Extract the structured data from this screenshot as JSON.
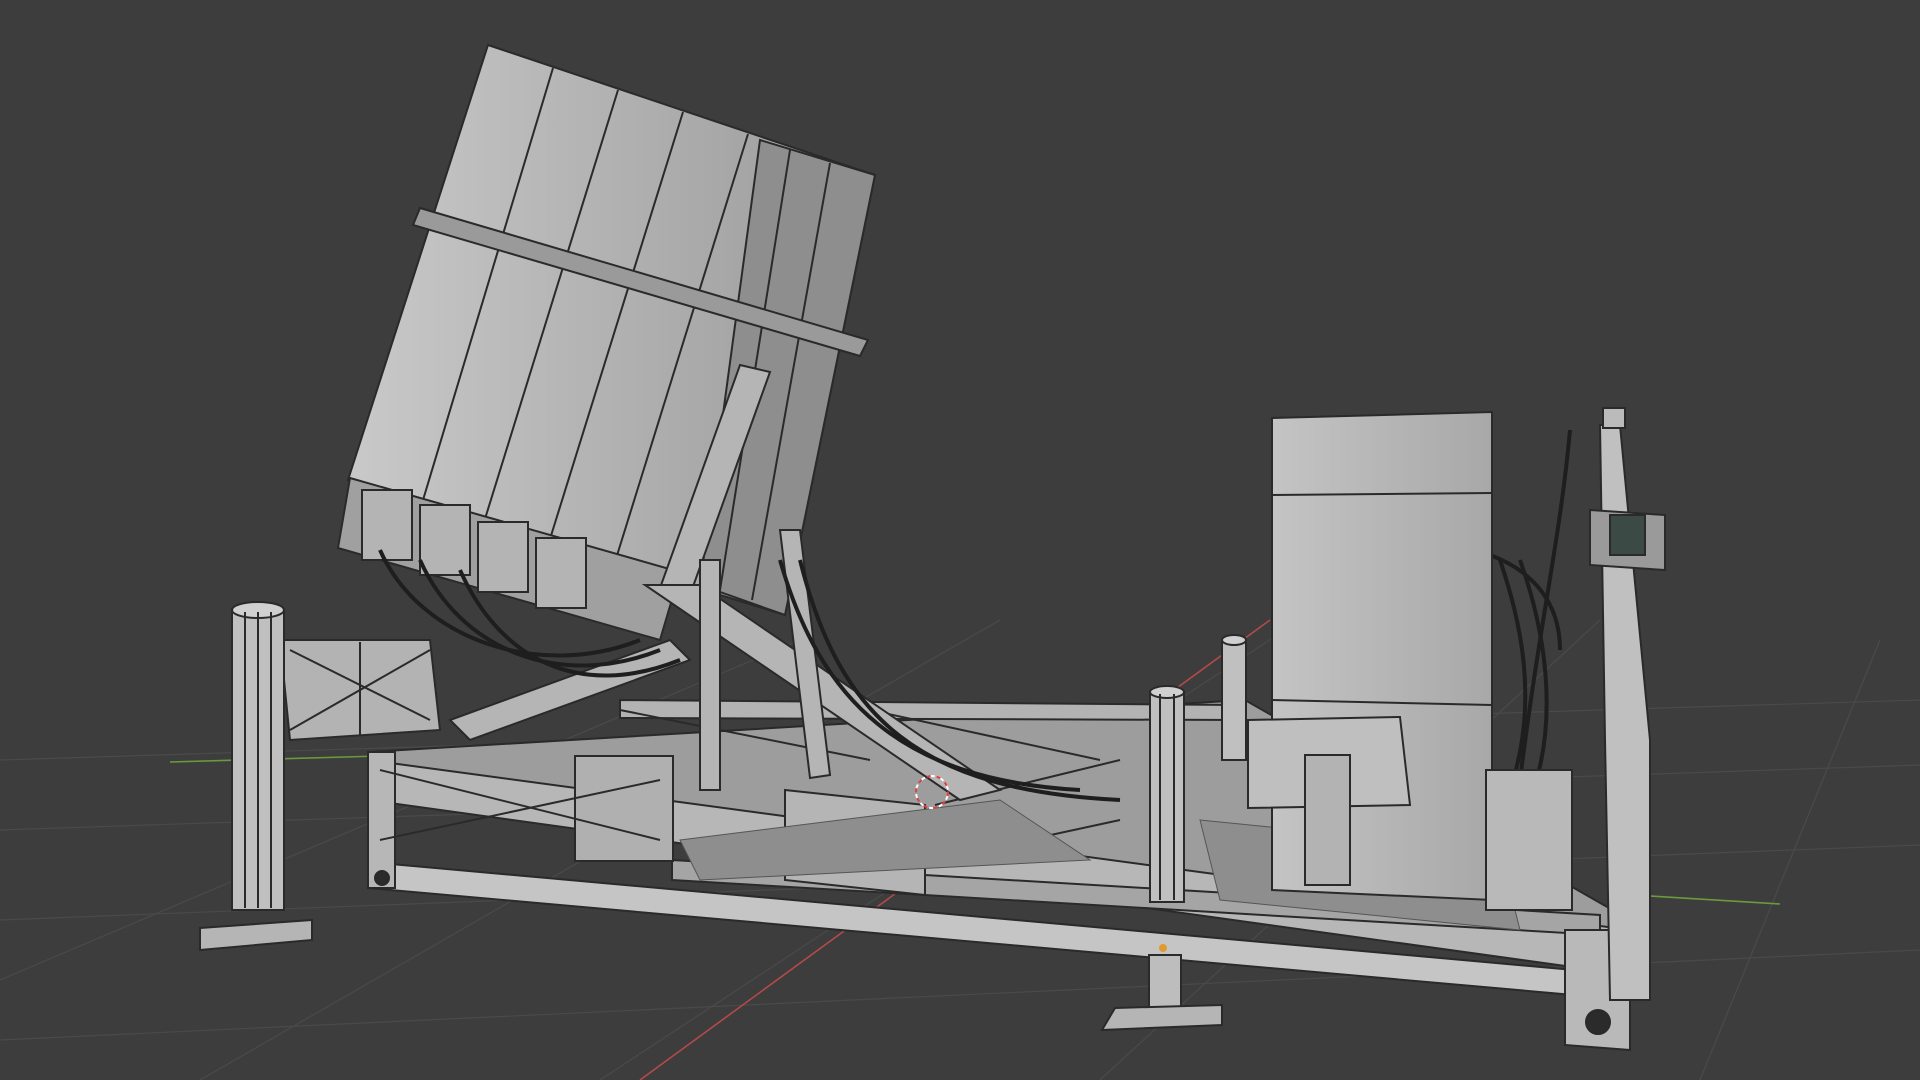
{
  "viewport": {
    "kind": "3d-viewport",
    "shading": "solid-wireframe",
    "background_color": "#3d3d3d",
    "grid_color": "#4a4a4a",
    "x_axis_color": "#b34a4a",
    "y_axis_color": "#6c9a3a",
    "model_color": "#b9b9b9",
    "edge_color": "#2a2a2a",
    "cursor_color": "#e04040"
  },
  "scene": {
    "object": "launcher-model",
    "parts": [
      "launcher-pod",
      "base-frame",
      "stabilizer-leg",
      "control-cabinet",
      "hydraulic-hose",
      "mast"
    ]
  }
}
